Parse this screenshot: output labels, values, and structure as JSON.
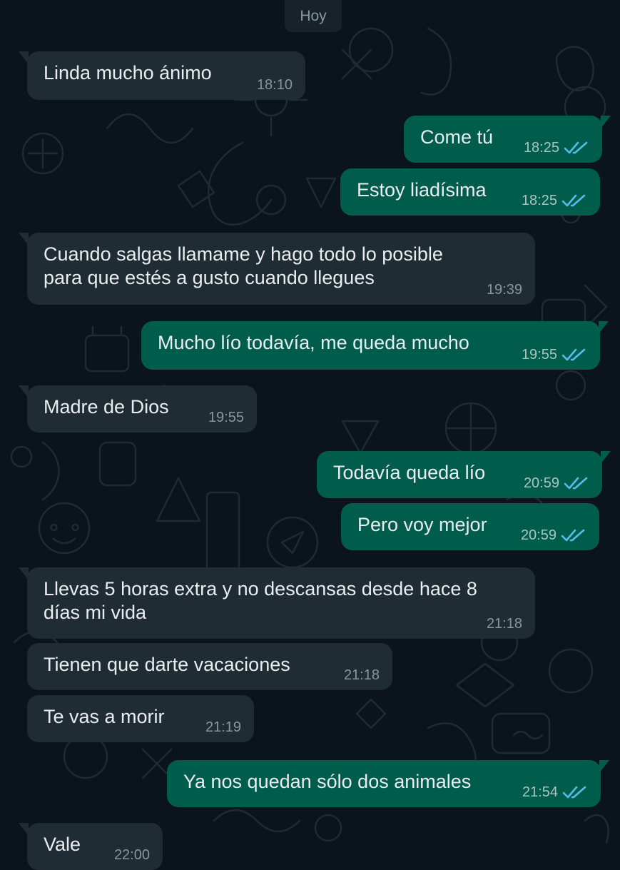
{
  "date_chip": "Hoy",
  "colors": {
    "background": "#0b141a",
    "incoming_bubble": "#202c33",
    "outgoing_bubble": "#005c4b",
    "read_ticks": "#53bdeb"
  },
  "messages": [
    {
      "dir": "in",
      "text": "Linda mucho ánimo",
      "time": "18:10"
    },
    {
      "dir": "out",
      "text": "Come tú",
      "time": "18:25",
      "status": "read"
    },
    {
      "dir": "out",
      "text": "Estoy liadísima",
      "time": "18:25",
      "status": "read"
    },
    {
      "dir": "in",
      "text": "Cuando salgas llamame y hago todo lo posible\npara que estés a gusto cuando llegues",
      "time": "19:39"
    },
    {
      "dir": "out",
      "text": "Mucho lío todavía, me queda mucho",
      "time": "19:55",
      "status": "read"
    },
    {
      "dir": "in",
      "text": "Madre de Dios",
      "time": "19:55"
    },
    {
      "dir": "out",
      "text": "Todavía queda lío",
      "time": "20:59",
      "status": "read"
    },
    {
      "dir": "out",
      "text": "Pero voy mejor",
      "time": "20:59",
      "status": "read"
    },
    {
      "dir": "in",
      "text": "Llevas 5 horas extra y no descansas desde hace 8\ndías mi vida",
      "time": "21:18"
    },
    {
      "dir": "in",
      "text": "Tienen que darte vacaciones",
      "time": "21:18"
    },
    {
      "dir": "in",
      "text": "Te vas a morir",
      "time": "21:19"
    },
    {
      "dir": "out",
      "text": "Ya nos quedan sólo dos animales",
      "time": "21:54",
      "status": "read"
    },
    {
      "dir": "in",
      "text": "Vale",
      "time": "22:00"
    }
  ]
}
